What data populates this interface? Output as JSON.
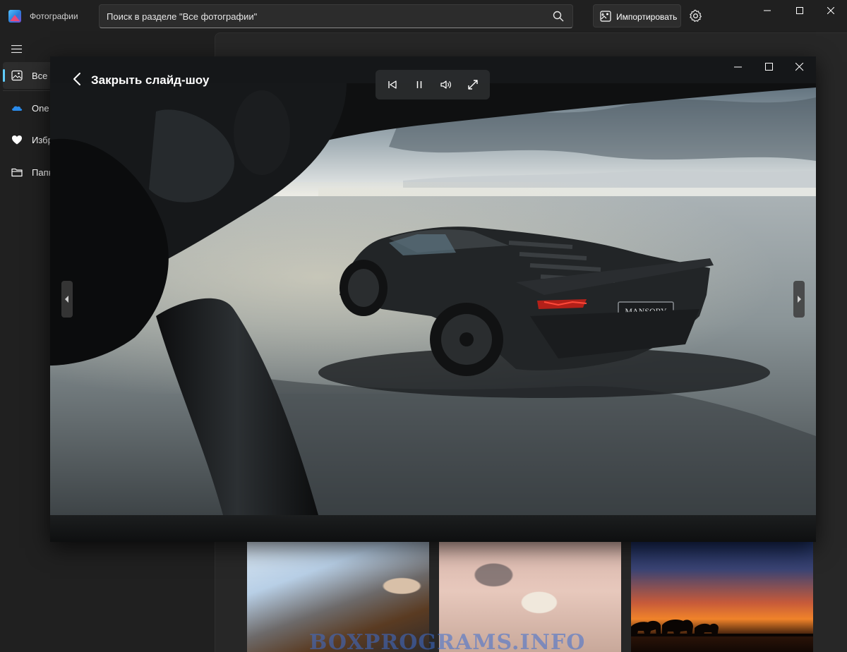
{
  "app": {
    "title": "Фотографии",
    "accent": "#60cdff"
  },
  "search": {
    "value": "Поиск в разделе \"Все фотографии\"",
    "icon": "search-icon"
  },
  "toolbar": {
    "import_label": "Импортировать",
    "settings_icon": "gear-icon"
  },
  "window_controls": [
    "minimize",
    "maximize",
    "close"
  ],
  "sidebar": {
    "items": [
      {
        "label": "Все",
        "icon": "image-icon",
        "active": true
      },
      {
        "label": "One",
        "icon": "onedrive-icon",
        "active": false
      },
      {
        "label": "Избр",
        "icon": "heart-icon",
        "active": false
      },
      {
        "label": "Папк",
        "icon": "folder-icon",
        "active": false
      }
    ]
  },
  "slideshow": {
    "title": "Закрыть слайд-шоу",
    "controls": [
      "previous-icon",
      "pause-icon",
      "volume-icon",
      "fullscreen-icon"
    ],
    "plate_text": "MANSORY"
  },
  "watermark": "BOXPROGRAMS.INFO"
}
